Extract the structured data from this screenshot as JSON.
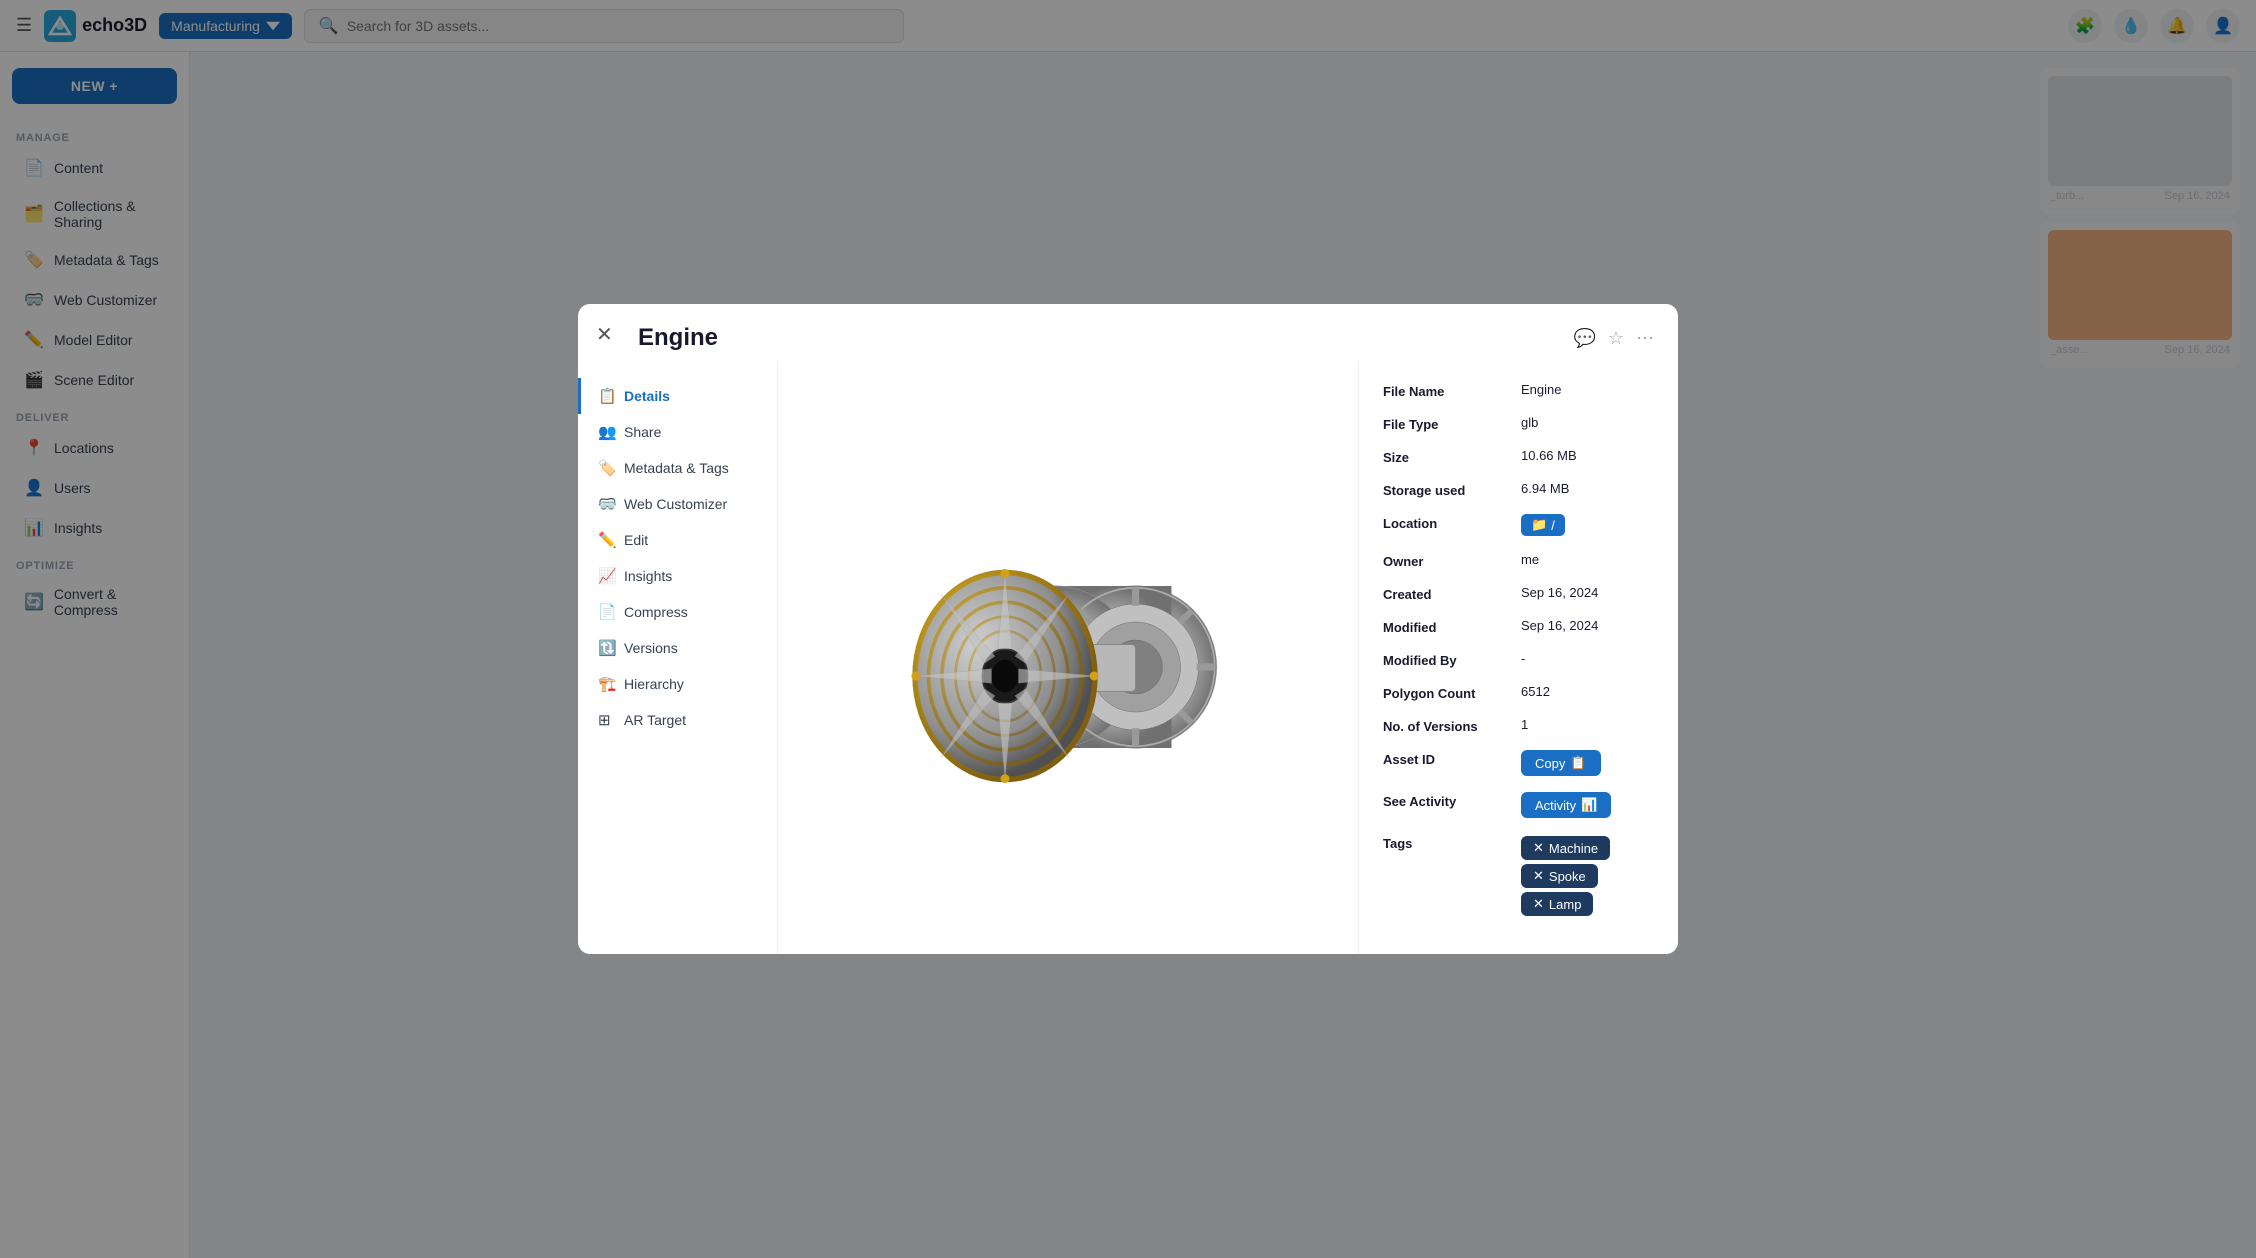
{
  "app": {
    "title": "echo3D",
    "workspace": "Manufacturing",
    "search_placeholder": "Search for 3D assets..."
  },
  "sidebar": {
    "new_button": "NEW +",
    "sections": [
      {
        "label": "MANAGE",
        "items": [
          {
            "id": "content",
            "label": "Content",
            "icon": "📄"
          },
          {
            "id": "collections",
            "label": "Collections & Sharing",
            "icon": "🗂️"
          },
          {
            "id": "metadata",
            "label": "Metadata & Tags",
            "icon": "🏷️"
          },
          {
            "id": "web-customizer",
            "label": "Web Customizer",
            "icon": "🥽"
          },
          {
            "id": "model-editor",
            "label": "Model Editor",
            "icon": "✏️"
          },
          {
            "id": "scene-editor",
            "label": "Scene Editor",
            "icon": "🎬"
          }
        ]
      },
      {
        "label": "DELIVER",
        "items": [
          {
            "id": "locations",
            "label": "Locations",
            "icon": "📍"
          },
          {
            "id": "users",
            "label": "Users",
            "icon": "👤"
          },
          {
            "id": "insights",
            "label": "Insights",
            "icon": "📊"
          }
        ]
      },
      {
        "label": "OPTIMIZE",
        "items": [
          {
            "id": "convert",
            "label": "Convert & Compress",
            "icon": "🔄"
          }
        ]
      }
    ]
  },
  "modal": {
    "title": "Engine",
    "nav_items": [
      {
        "id": "details",
        "label": "Details",
        "icon": "📋",
        "active": true
      },
      {
        "id": "share",
        "label": "Share",
        "icon": "👥"
      },
      {
        "id": "metadata-tags",
        "label": "Metadata & Tags",
        "icon": "🏷️"
      },
      {
        "id": "web-customizer",
        "label": "Web Customizer",
        "icon": "🥽"
      },
      {
        "id": "edit",
        "label": "Edit",
        "icon": "✏️"
      },
      {
        "id": "insights",
        "label": "Insights",
        "icon": "📈"
      },
      {
        "id": "compress",
        "label": "Compress",
        "icon": "📄"
      },
      {
        "id": "versions",
        "label": "Versions",
        "icon": "🔃"
      },
      {
        "id": "hierarchy",
        "label": "Hierarchy",
        "icon": "🏗️"
      },
      {
        "id": "ar-target",
        "label": "AR Target",
        "icon": "⊞"
      }
    ],
    "details": {
      "file_name_label": "File Name",
      "file_name_value": "Engine",
      "file_type_label": "File Type",
      "file_type_value": "glb",
      "size_label": "Size",
      "size_value": "10.66 MB",
      "storage_used_label": "Storage used",
      "storage_used_value": "6.94 MB",
      "location_label": "Location",
      "location_value": "/",
      "owner_label": "Owner",
      "owner_value": "me",
      "created_label": "Created",
      "created_value": "Sep 16, 2024",
      "modified_label": "Modified",
      "modified_value": "Sep 16, 2024",
      "modified_by_label": "Modified By",
      "modified_by_value": "-",
      "polygon_count_label": "Polygon Count",
      "polygon_count_value": "6512",
      "no_of_versions_label": "No. of Versions",
      "no_of_versions_value": "1",
      "asset_id_label": "Asset ID",
      "copy_btn_label": "Copy",
      "see_activity_label": "See Activity",
      "activity_btn_label": "Activity",
      "tags_label": "Tags",
      "tags": [
        {
          "label": "Machine"
        },
        {
          "label": "Spoke"
        },
        {
          "label": "Lamp"
        }
      ]
    }
  }
}
